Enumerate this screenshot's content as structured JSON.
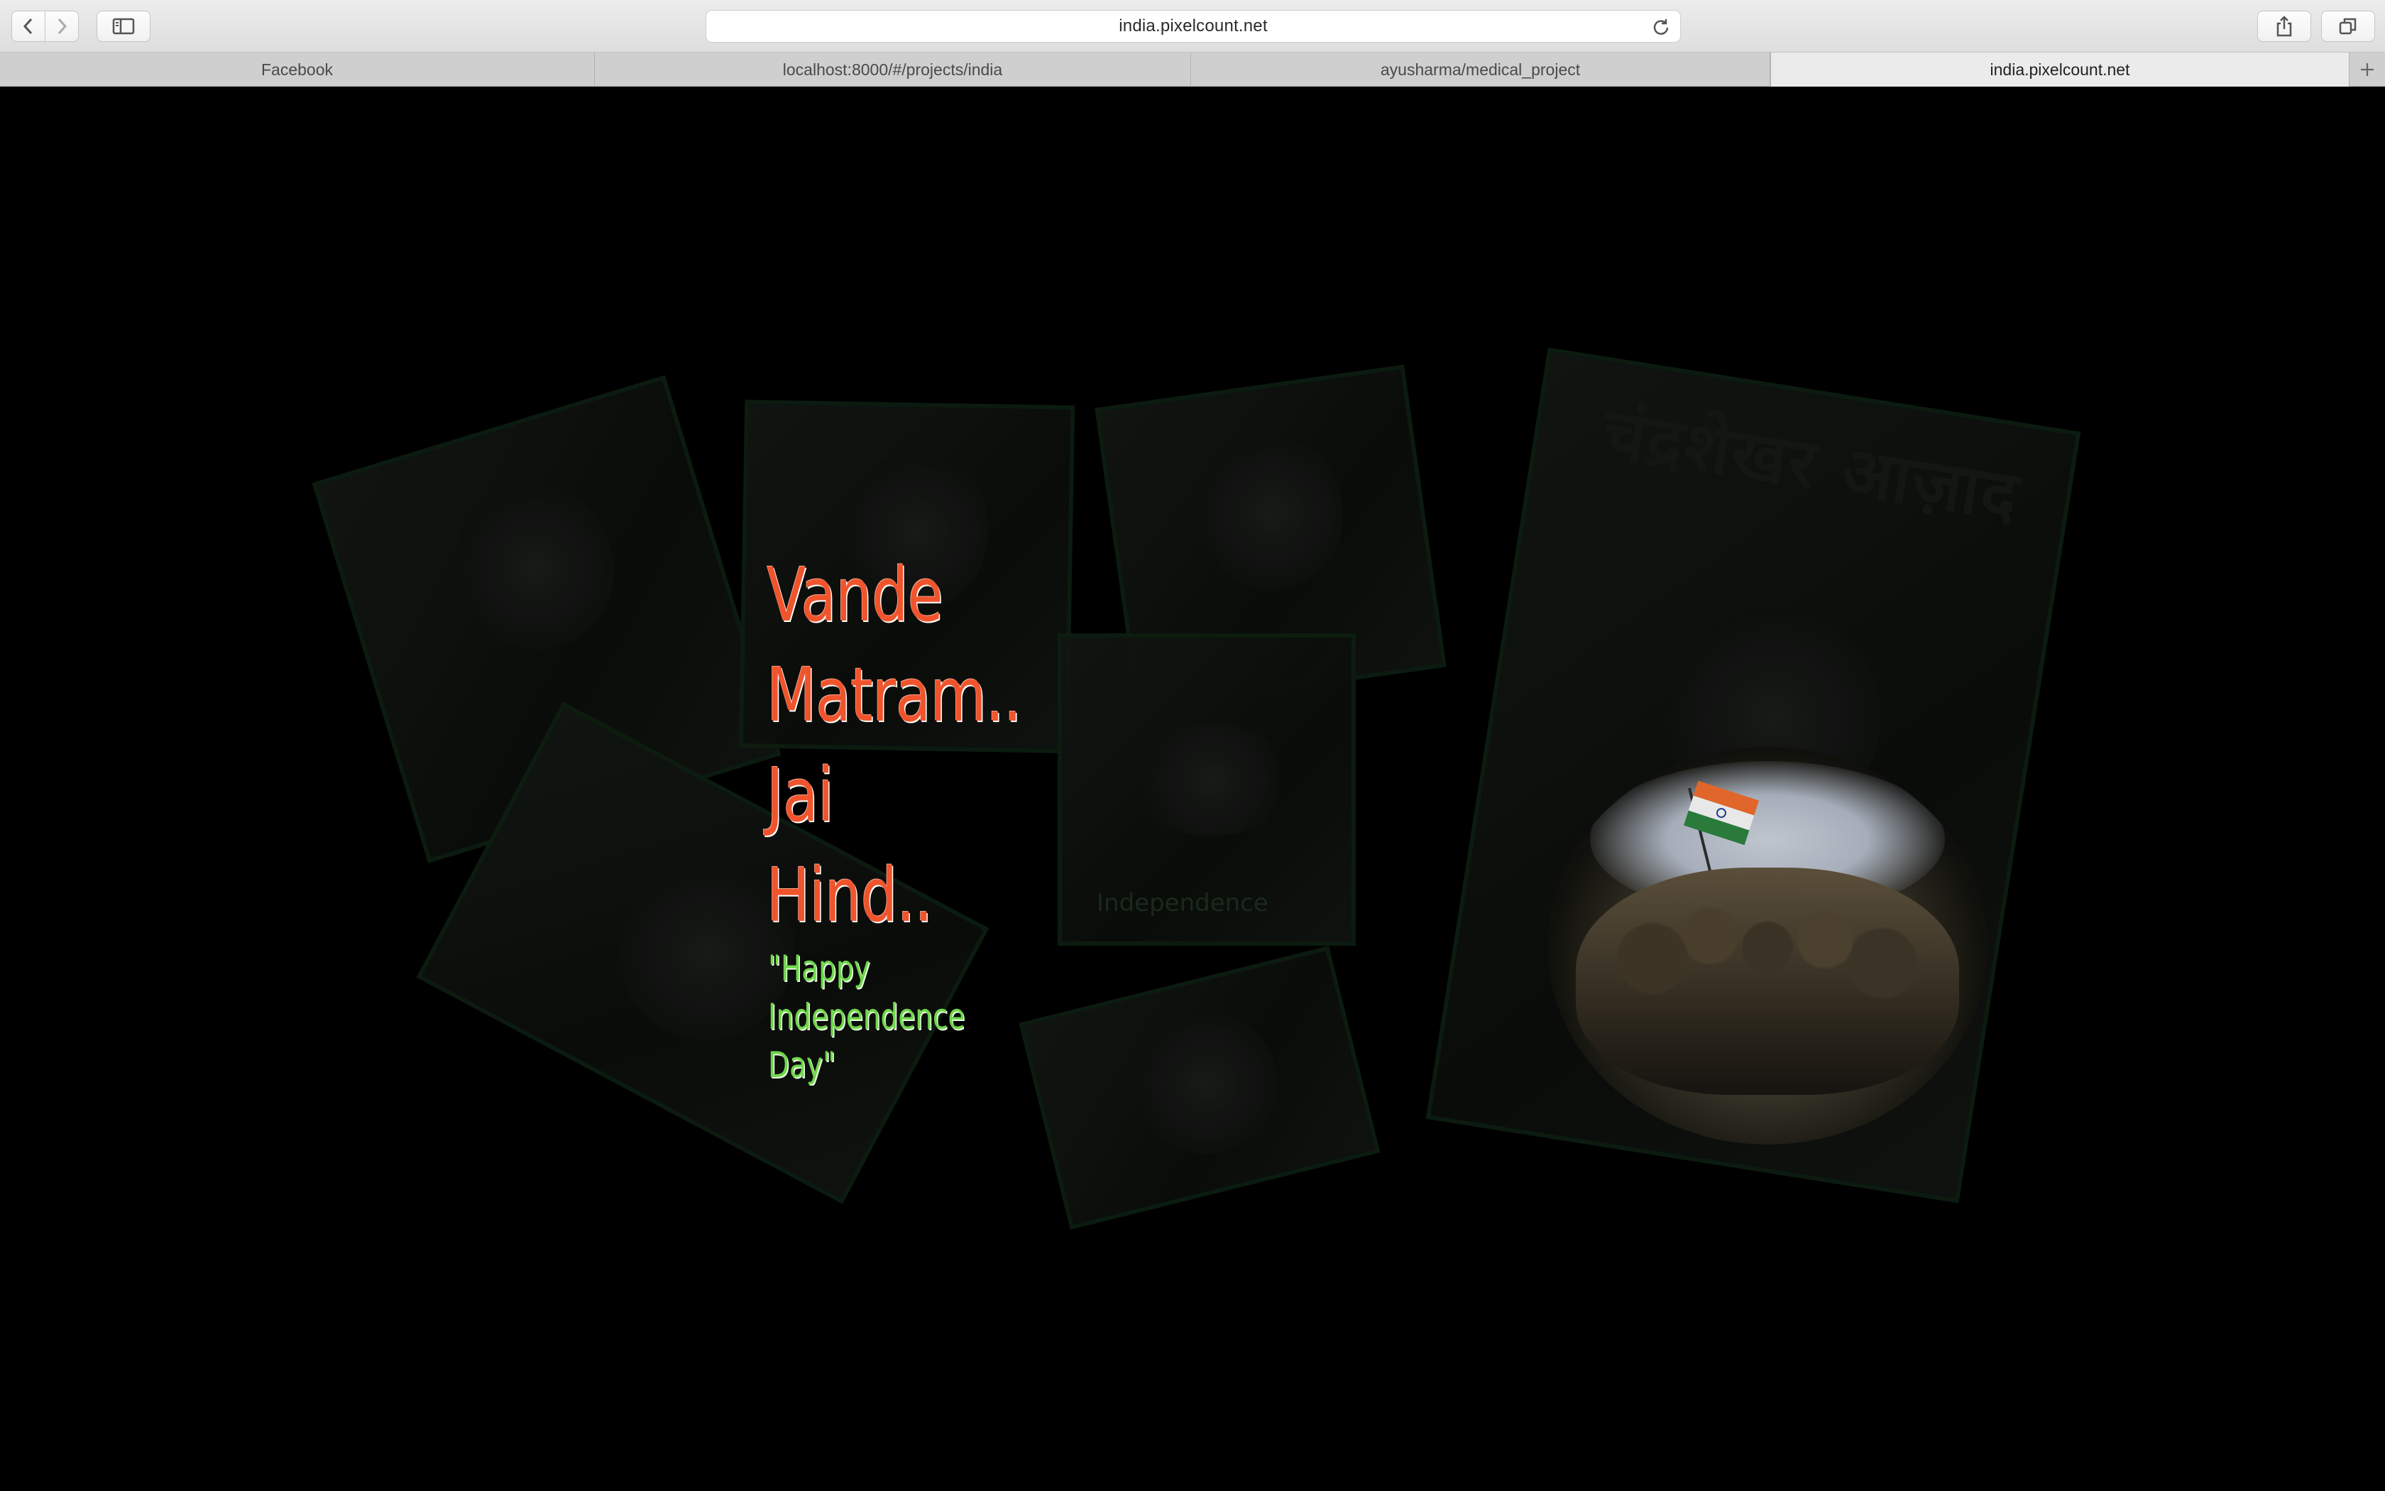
{
  "browser": {
    "url": "india.pixelcount.net",
    "tabs": [
      {
        "label": "Facebook",
        "active": false
      },
      {
        "label": "localhost:8000/#/projects/india",
        "active": false
      },
      {
        "label": "ayusharma/medical_project",
        "active": false
      },
      {
        "label": "india.pixelcount.net",
        "active": true
      }
    ],
    "icons": [
      "back-icon",
      "forward-icon",
      "sidebar-icon",
      "reload-icon",
      "share-icon",
      "tabs-overview-icon",
      "new-tab-icon"
    ]
  },
  "page": {
    "background": "#000000",
    "slogan_lines": [
      "Vande",
      "Matram..",
      "Jai",
      "Hind.."
    ],
    "greeting_lines": [
      "\"Happy",
      "Independence",
      "Day\""
    ],
    "slogan_color": "#f0542c",
    "greeting_color": "#6fd64b",
    "background_label": "Independence"
  }
}
